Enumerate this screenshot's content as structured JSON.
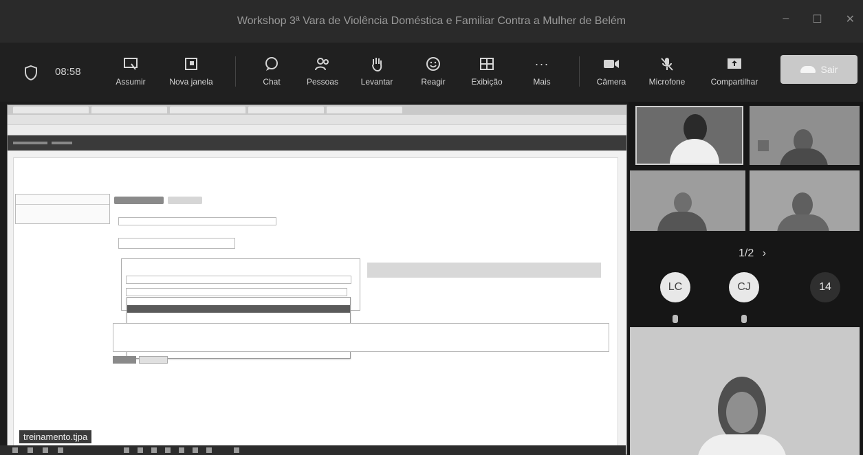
{
  "window": {
    "title": "Workshop 3ª Vara de Violência Doméstica e Familiar Contra a Mulher de Belém"
  },
  "toolbar": {
    "timer": "08:58",
    "buttons": [
      {
        "label": "Assumir",
        "icon": "take-control-icon"
      },
      {
        "label": "Nova janela",
        "icon": "new-window-icon"
      },
      {
        "label": "Chat",
        "icon": "chat-icon"
      },
      {
        "label": "Pessoas",
        "icon": "people-icon"
      },
      {
        "label": "Levantar",
        "icon": "raise-hand-icon"
      },
      {
        "label": "Reagir",
        "icon": "react-icon"
      },
      {
        "label": "Exibição",
        "icon": "view-icon"
      },
      {
        "label": "Mais",
        "icon": "more-icon"
      },
      {
        "label": "Câmera",
        "icon": "camera-icon"
      },
      {
        "label": "Microfone",
        "icon": "microphone-off-icon"
      },
      {
        "label": "Compartilhar",
        "icon": "share-icon"
      }
    ],
    "leave_label": "Sair"
  },
  "gallery": {
    "pager": "1/2",
    "avatars": [
      {
        "initials": "LC"
      },
      {
        "initials": "CJ"
      }
    ],
    "overflow_count": "14"
  },
  "shared_screen": {
    "watermark": "treinamento.tjpa"
  },
  "colors": {
    "leave_button": "#c9c9c9",
    "toolbar_bg": "#202020",
    "titlebar_bg": "#2a2a2a"
  }
}
